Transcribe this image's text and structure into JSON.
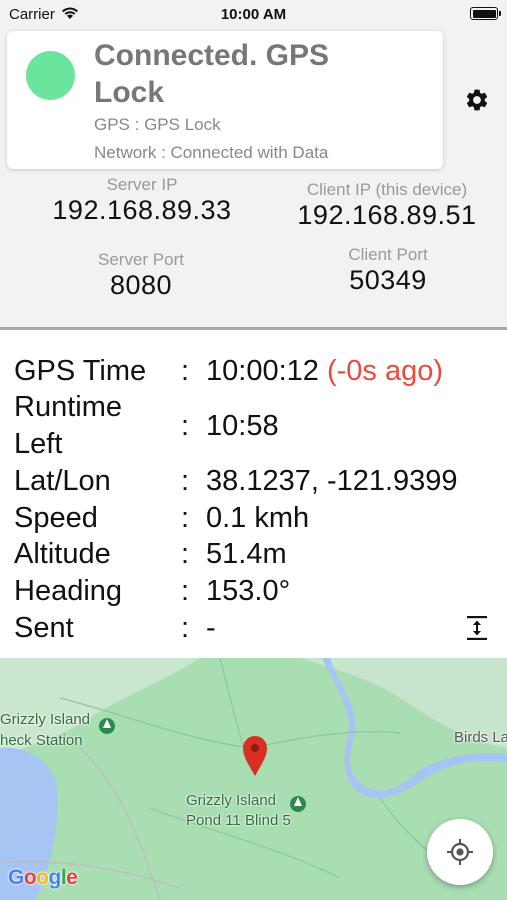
{
  "status_bar": {
    "carrier": "Carrier",
    "time": "10:00 AM"
  },
  "connection": {
    "title": "Connected. GPS Lock",
    "gps_line": "GPS : GPS Lock",
    "network_line": "Network : Connected with Data",
    "indicator_color": "#6be59e"
  },
  "ips": {
    "server_ip_label": "Server IP",
    "server_ip": "192.168.89.33",
    "client_ip_label": "Client IP (this device)",
    "client_ip": "192.168.89.51",
    "server_port_label": "Server Port",
    "server_port": "8080",
    "client_port_label": "Client Port",
    "client_port": "50349"
  },
  "info": {
    "separator": ":",
    "gps_time_label": "GPS Time",
    "gps_time": "10:00:12",
    "gps_time_ago": "(-0s ago)",
    "runtime_label_1": "Runtime",
    "runtime_label_2": "Left",
    "runtime": "10:58",
    "latlon_label": "Lat/Lon",
    "latlon": "38.1237, -121.9399",
    "speed_label": "Speed",
    "speed": "0.1 kmh",
    "altitude_label": "Altitude",
    "altitude": "51.4m",
    "heading_label": "Heading",
    "heading": "153.0°",
    "sent_label": "Sent",
    "sent": "-"
  },
  "map": {
    "label_checkstation_1": "Grizzly Island",
    "label_checkstation_2": "heck Station",
    "label_pond_1": "Grizzly Island",
    "label_pond_2": "Pond 11 Blind 5",
    "label_birds": "Birds La",
    "google": "Google"
  },
  "colors": {
    "ago_text": "#e74c3c",
    "map_land": "#a9ddb2",
    "map_water": "#a7c5f2",
    "pin": "#d93025"
  }
}
